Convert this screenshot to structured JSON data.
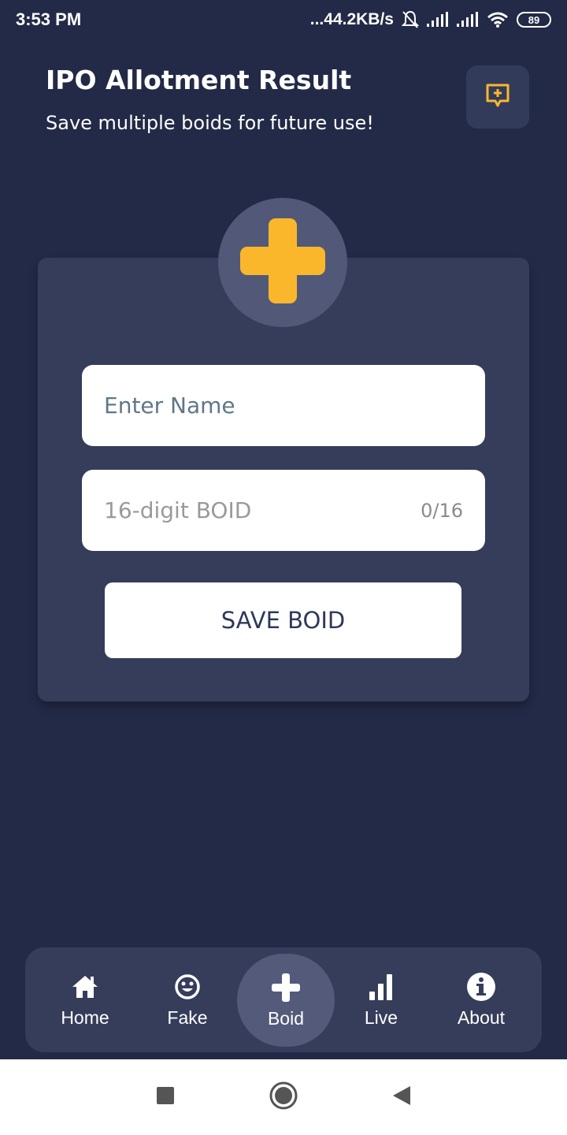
{
  "status_bar": {
    "time": "3:53 PM",
    "network_speed": "...44.2KB/s",
    "battery_level": "89",
    "icons": [
      "bell-off-icon",
      "signal-icon",
      "signal-icon",
      "wifi-icon",
      "battery-icon"
    ]
  },
  "header": {
    "title": "IPO Allotment Result",
    "subtitle": "Save multiple boids for future use!",
    "feedback_icon": "feedback-add-icon"
  },
  "form": {
    "badge_icon": "plus-icon",
    "name_placeholder": "Enter Name",
    "boid_placeholder": "16-digit BOID",
    "boid_counter": "0/16",
    "save_label": "SAVE BOID"
  },
  "nav": {
    "items": [
      {
        "label": "Home",
        "icon": "home-icon",
        "active": false
      },
      {
        "label": "Fake",
        "icon": "smile-icon",
        "active": false
      },
      {
        "label": "Boid",
        "icon": "plus-icon",
        "active": true
      },
      {
        "label": "Live",
        "icon": "bar-chart-icon",
        "active": false
      },
      {
        "label": "About",
        "icon": "info-icon",
        "active": false
      }
    ]
  },
  "colors": {
    "background": "#232a47",
    "card": "#363d5b",
    "accent": "#fbb72c",
    "button_text": "#2f3859"
  }
}
